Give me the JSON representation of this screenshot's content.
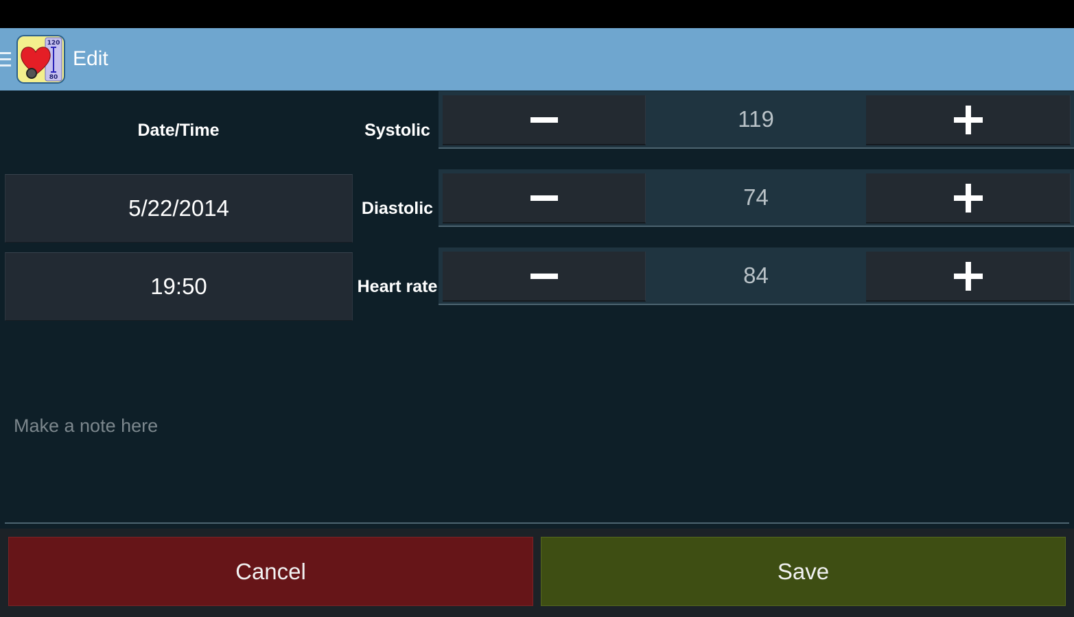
{
  "action_bar": {
    "title": "Edit",
    "icon_name": "blood-pressure-app-icon",
    "icon_labels": {
      "top": "120",
      "bottom": "80"
    }
  },
  "datetime": {
    "label": "Date/Time",
    "date": "5/22/2014",
    "time": "19:50"
  },
  "measurements": [
    {
      "label": "Systolic",
      "value": "119"
    },
    {
      "label": "Diastolic",
      "value": "74"
    },
    {
      "label": "Heart rate",
      "value": "84"
    }
  ],
  "note": {
    "placeholder": "Make a note here",
    "value": ""
  },
  "actions": {
    "cancel_label": "Cancel",
    "save_label": "Save"
  },
  "colors": {
    "action_bar": "#6fa6cf",
    "background": "#0e1f28",
    "cancel": "#661518",
    "save": "#3e4e13"
  }
}
